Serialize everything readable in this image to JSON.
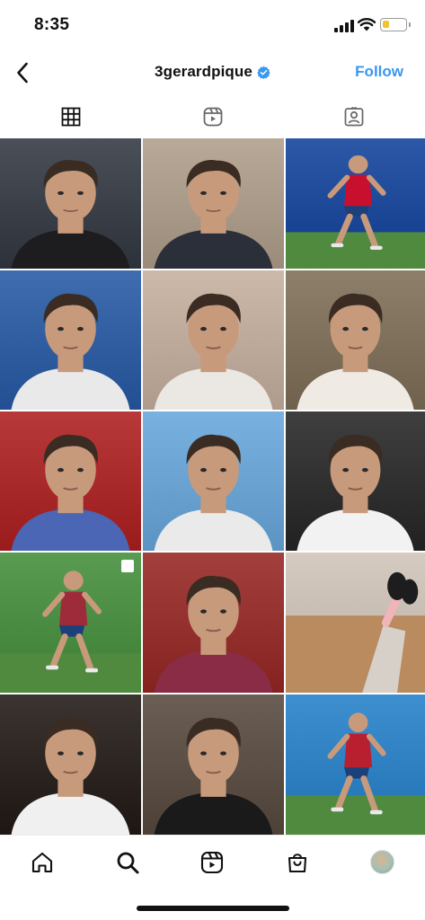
{
  "status_bar": {
    "time": "8:35",
    "battery_color": "#f1c232",
    "battery_level": 0.28
  },
  "header": {
    "back_icon": "chevron-left-icon",
    "username": "3gerardpique",
    "verified": true,
    "verified_color": "#3897f0",
    "follow_label": "Follow",
    "follow_color": "#3897f0"
  },
  "tabs": [
    {
      "name": "posts",
      "icon": "grid-icon",
      "active": true
    },
    {
      "name": "reels",
      "icon": "reels-icon",
      "active": false
    },
    {
      "name": "tagged",
      "icon": "tagged-icon",
      "active": false
    }
  ],
  "grid": {
    "posts": [
      {
        "id": 1,
        "kind": "selfie",
        "bg": "#4a4f58",
        "shirt": "#1d1d1f"
      },
      {
        "id": 2,
        "kind": "selfie",
        "bg": "#b8a998",
        "shirt": "#2a2f3a"
      },
      {
        "id": 3,
        "kind": "action",
        "bg": "#2d58a8",
        "shirt": "#c8102e"
      },
      {
        "id": 4,
        "kind": "selfie",
        "bg": "#3f6db0",
        "shirt": "#e9e9e9"
      },
      {
        "id": 5,
        "kind": "selfie",
        "bg": "#cdb9aa",
        "shirt": "#ebe7e3"
      },
      {
        "id": 6,
        "kind": "selfie",
        "bg": "#8d7f6a",
        "shirt": "#efeae3"
      },
      {
        "id": 7,
        "kind": "selfie",
        "bg": "#b8393a",
        "shirt": "#4a66b5"
      },
      {
        "id": 8,
        "kind": "selfie",
        "bg": "#79b1e0",
        "shirt": "#eaeaea"
      },
      {
        "id": 9,
        "kind": "selfie",
        "bg": "#3f3f3f",
        "shirt": "#f2f2f2"
      },
      {
        "id": 10,
        "kind": "action",
        "bg": "#5a9b52",
        "shirt": "#9e2b3a",
        "multi": true
      },
      {
        "id": 11,
        "kind": "selfie",
        "bg": "#a3403e",
        "shirt": "#8a2c45"
      },
      {
        "id": 12,
        "kind": "feet",
        "bg": "#d5cbc0",
        "shirt": "#1d1d1d"
      },
      {
        "id": 13,
        "kind": "selfie",
        "bg": "#3b3430",
        "shirt": "#f0f0f0"
      },
      {
        "id": 14,
        "kind": "selfie",
        "bg": "#6b5f55",
        "shirt": "#1a1a1a"
      },
      {
        "id": 15,
        "kind": "action",
        "bg": "#3d8fd0",
        "shirt": "#b8202f"
      }
    ]
  },
  "bottom_nav": [
    {
      "name": "home",
      "icon": "home-icon"
    },
    {
      "name": "search",
      "icon": "search-icon"
    },
    {
      "name": "reels",
      "icon": "reels-icon"
    },
    {
      "name": "shop",
      "icon": "shop-icon"
    },
    {
      "name": "profile",
      "icon": "avatar"
    }
  ]
}
